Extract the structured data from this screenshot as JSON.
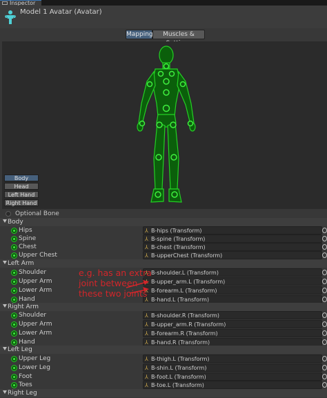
{
  "window": {
    "tab_label": "Inspector",
    "title": "Model 1 Avatar (Avatar)"
  },
  "tabs": {
    "mapping": "Mapping",
    "muscles": "Muscles & Settings"
  },
  "body_parts": [
    "Body",
    "Head",
    "Left Hand",
    "Right Hand"
  ],
  "optional_bone_label": "Optional Bone",
  "groups": [
    {
      "label": "Body",
      "bones": [
        {
          "name": "Hips",
          "transform": "B-hips (Transform)"
        },
        {
          "name": "Spine",
          "transform": "B-spine (Transform)"
        },
        {
          "name": "Chest",
          "transform": "B-chest (Transform)"
        },
        {
          "name": "Upper Chest",
          "transform": "B-upperChest (Transform)"
        }
      ]
    },
    {
      "label": "Left Arm",
      "bones": [
        {
          "name": "Shoulder",
          "transform": "B-shoulder.L (Transform)"
        },
        {
          "name": "Upper Arm",
          "transform": "B-upper_arm.L (Transform)"
        },
        {
          "name": "Lower Arm",
          "transform": "B-forearm.L (Transform)"
        },
        {
          "name": "Hand",
          "transform": "B-hand.L (Transform)"
        }
      ]
    },
    {
      "label": "Right Arm",
      "bones": [
        {
          "name": "Shoulder",
          "transform": "B-shoulder.R (Transform)"
        },
        {
          "name": "Upper Arm",
          "transform": "B-upper_arm.R (Transform)"
        },
        {
          "name": "Lower Arm",
          "transform": "B-forearm.R (Transform)"
        },
        {
          "name": "Hand",
          "transform": "B-hand.R (Transform)"
        }
      ]
    },
    {
      "label": "Left Leg",
      "bones": [
        {
          "name": "Upper Leg",
          "transform": "B-thigh.L (Transform)"
        },
        {
          "name": "Lower Leg",
          "transform": "B-shin.L (Transform)"
        },
        {
          "name": "Foot",
          "transform": "B-foot.L (Transform)"
        },
        {
          "name": "Toes",
          "transform": "B-toe.L (Transform)"
        }
      ]
    },
    {
      "label": "Right Leg",
      "bones": []
    }
  ],
  "annotation": "e.g. has an extra joint between these two joints",
  "colors": {
    "accent": "#46607c",
    "figure": "#1fc41f",
    "annotation": "#d2262a"
  }
}
